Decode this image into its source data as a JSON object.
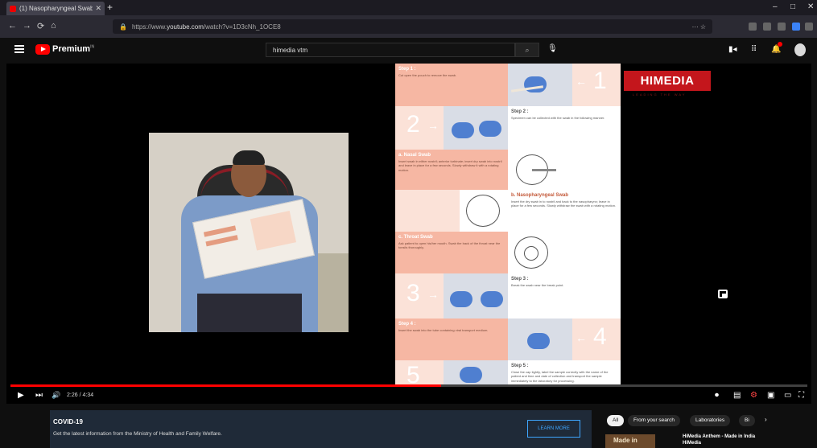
{
  "browser": {
    "tab_title": "(1) Nasopharyngeal Swab - Yo...",
    "tab_close": "✕",
    "new_tab": "+",
    "minimize": "–",
    "maximize": "□",
    "close": "✕",
    "back": "←",
    "forward": "→",
    "reload": "⟳",
    "home": "⌂",
    "url_prefix": "https://www.",
    "url_host": "youtube.com",
    "url_path": "/watch?v=1D3cNh_1OCE8",
    "lock": "🔒",
    "page_actions": "··· ☆"
  },
  "masthead": {
    "logo_text": "Premium",
    "logo_sup": "IN",
    "search_value": "himedia vtm",
    "search_icon": "⌕",
    "mic_icon": "🎙",
    "create_icon": "▮◂",
    "apps_icon": "⠿",
    "bell_icon": "🔔"
  },
  "leaflet": {
    "step1_title": "Step 1 :",
    "step1_text": "Cut open the pouch to remove the swab.",
    "num1": "1",
    "step2_title": "Step 2 :",
    "step2_text": "Specimen can be collected with the swab in the following manner.",
    "num2": "2",
    "nasal_title": "a. Nasal Swab",
    "nasal_text": "Insert swab in either nostril; anterior turbinate; insert dry swab into nostril and leave in place for a few seconds. Slowly withdraw it with a rotating motion.",
    "naso_title": "b. Nasopharyngeal Swab",
    "naso_text": "Insert the dry swab in to nostril and back to the nasopharynx; leave in place for a few seconds. Slowly withdraw the swab with a rotating motion.",
    "throat_title": "c. Throat Swab",
    "throat_text": "Ask patient to open his/her mouth. Swab the back of the throat near the tonsils thoroughly.",
    "num3": "3",
    "step3_title": "Step 3 :",
    "step3_text": "Break the swab near the break point.",
    "step4_title": "Step 4 :",
    "step4_text": "Insert the swab into the tube containing viral transport medium.",
    "num4": "4",
    "num5": "5",
    "step5_title": "Step 5 :",
    "step5_text": "Close the cap tightly, label the sample correctly with the name of the patient and time and date of collection and transport the sample immediately to the laboratory for processing."
  },
  "overlay": {
    "brand": "HIMEDIA",
    "brand_sub": "LEADING THE WAY"
  },
  "player": {
    "progress_fraction": 0.54,
    "play_icon": "▶",
    "next_icon": "⏭",
    "volume_icon": "🔊",
    "time": "2:26 / 4:34",
    "autoplay_icon": "⏺",
    "subtitles_icon": "▤",
    "settings_icon": "⚙",
    "miniplayer_icon": "▣",
    "theater_icon": "▭",
    "fullscreen_icon": "⛶"
  },
  "covid_banner": {
    "title": "COVID-19",
    "text": "Get the latest information from the Ministry of Health and Family Welfare.",
    "button": "LEARN MORE"
  },
  "chips": [
    "All",
    "From your search",
    "Laboratories",
    "Bi"
  ],
  "chip_next": "›",
  "recommendation": {
    "thumb_text": "Made in",
    "title": "HiMedia Anthem - Made in India HiMedia"
  },
  "colors": {
    "accent": "#ff0000",
    "brand_red": "#c4161c",
    "leaflet_peach": "#f6b7a3",
    "link_blue": "#3ea6ff"
  }
}
